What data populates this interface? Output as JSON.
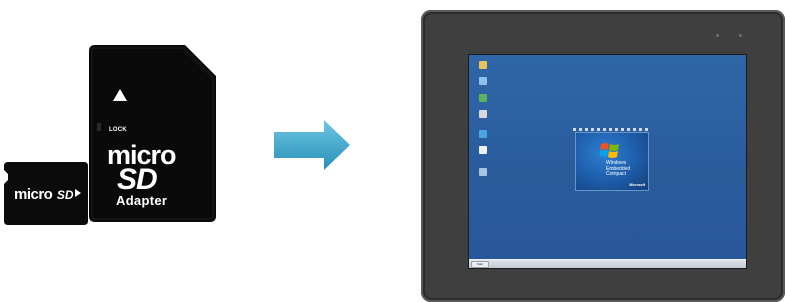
{
  "sd_adapter": {
    "lock_text": "LOCK",
    "logo_micro": "micro",
    "logo_sd": "SD",
    "label": "Adapter",
    "body_color": "#000000",
    "text_color": "#ffffff"
  },
  "microsd_card": {
    "logo_micro": "micro",
    "logo_sd": "SD",
    "arrow_glyph": "triangle-right"
  },
  "transfer_arrow": {
    "icon": "arrow-right-icon",
    "color": "#36a6c9"
  },
  "panel": {
    "bezel_color": "#3f3f3f",
    "screen_color": "#2f66a8",
    "desktop": {
      "icons": [
        "folder-icon",
        "computer-icon",
        "media-icon",
        "document-icon",
        "browser-icon",
        "tools-icon",
        "network-icon"
      ],
      "eval_title": "Windows Embedded Compact",
      "eval_brand": "Microsoft",
      "taskbar_start": "Start"
    }
  }
}
